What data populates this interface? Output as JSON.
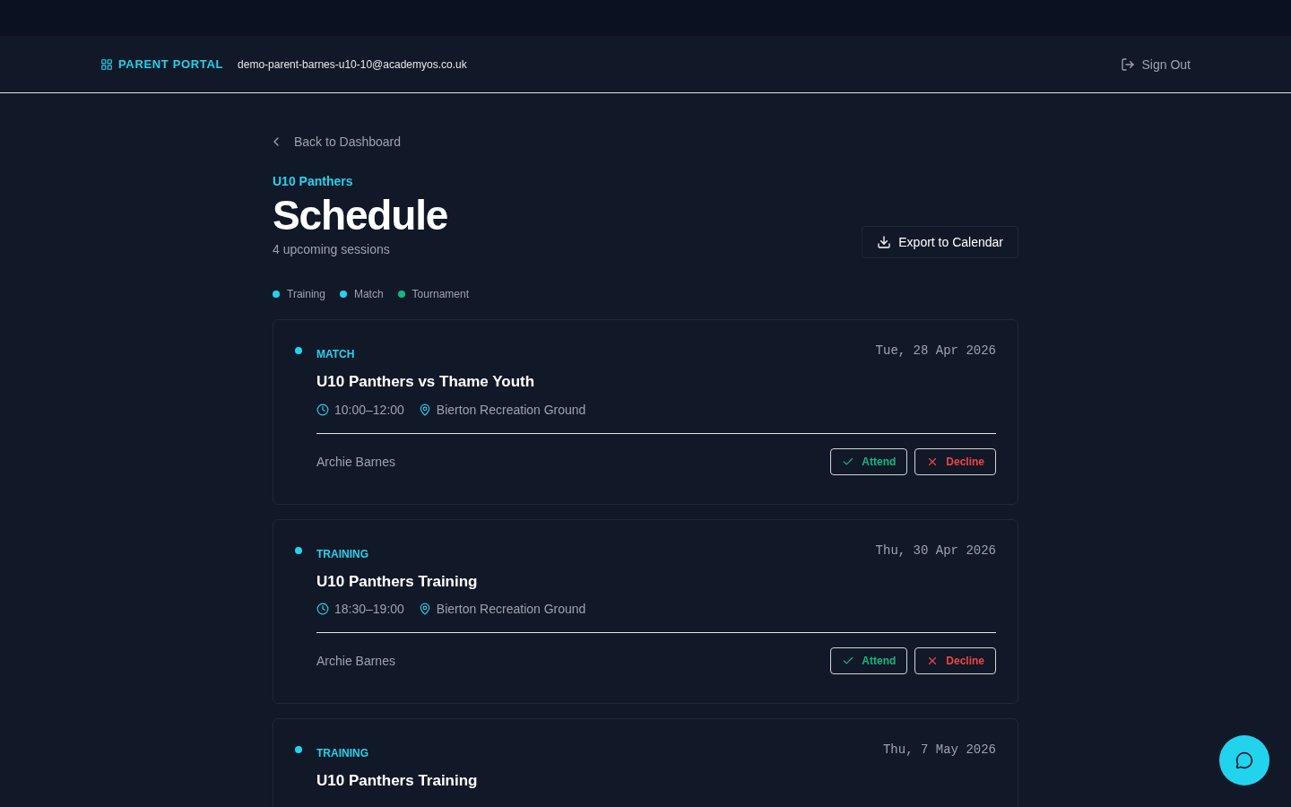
{
  "header": {
    "brand": "PARENT PORTAL",
    "email": "demo-parent-barnes-u10-10@academyos.co.uk",
    "sign_out": "Sign Out"
  },
  "back_link": "Back to Dashboard",
  "team": "U10 Panthers",
  "title": "Schedule",
  "subtitle": "4 upcoming sessions",
  "export_button": "Export to Calendar",
  "legend": [
    {
      "label": "Training",
      "color": "#22d3ee"
    },
    {
      "label": "Match",
      "color": "#22d3ee"
    },
    {
      "label": "Tournament",
      "color": "#10b981"
    }
  ],
  "sessions": [
    {
      "type": "MATCH",
      "color": "#22d3ee",
      "title": "U10 Panthers vs Thame Youth",
      "date": "Tue, 28 Apr 2026",
      "time": "10:00–12:00",
      "location": "Bierton Recreation Ground",
      "player": "Archie Barnes",
      "attend": "Attend",
      "decline": "Decline"
    },
    {
      "type": "TRAINING",
      "color": "#22d3ee",
      "title": "U10 Panthers Training",
      "date": "Thu, 30 Apr 2026",
      "time": "18:30–19:00",
      "location": "Bierton Recreation Ground",
      "player": "Archie Barnes",
      "attend": "Attend",
      "decline": "Decline"
    },
    {
      "type": "TRAINING",
      "color": "#22d3ee",
      "title": "U10 Panthers Training",
      "date": "Thu, 7 May 2026"
    }
  ]
}
